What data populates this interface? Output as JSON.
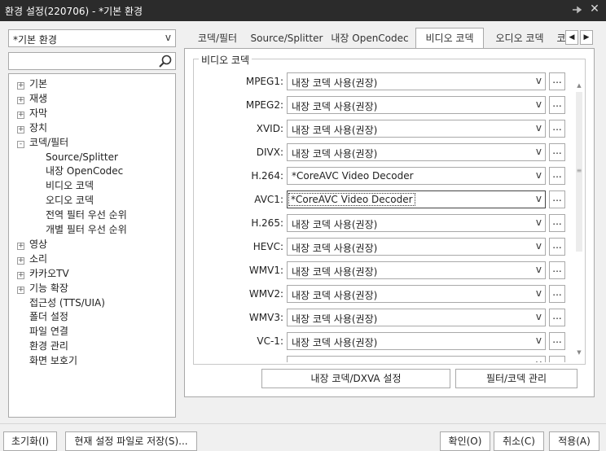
{
  "window": {
    "title": "환경 설정(220706) - *기본 환경",
    "pin_glyph": "‑◆",
    "close_glyph": "✕"
  },
  "profile": {
    "value": "*기본 환경",
    "arrow": "v"
  },
  "search": {
    "value": "",
    "placeholder": ""
  },
  "tree": [
    {
      "label": "기본",
      "level": 0,
      "expander": "+"
    },
    {
      "label": "재생",
      "level": 0,
      "expander": "+"
    },
    {
      "label": "자막",
      "level": 0,
      "expander": "+"
    },
    {
      "label": "장치",
      "level": 0,
      "expander": "+"
    },
    {
      "label": "코덱/필터",
      "level": 0,
      "expander": "-"
    },
    {
      "label": "Source/Splitter",
      "level": 1,
      "expander": ""
    },
    {
      "label": "내장 OpenCodec",
      "level": 1,
      "expander": ""
    },
    {
      "label": "비디오 코덱",
      "level": 1,
      "expander": ""
    },
    {
      "label": "오디오 코덱",
      "level": 1,
      "expander": ""
    },
    {
      "label": "전역 필터 우선 순위",
      "level": 1,
      "expander": ""
    },
    {
      "label": "개별 필터 우선 순위",
      "level": 1,
      "expander": ""
    },
    {
      "label": "영상",
      "level": 0,
      "expander": "+"
    },
    {
      "label": "소리",
      "level": 0,
      "expander": "+"
    },
    {
      "label": "카카오TV",
      "level": 0,
      "expander": "+"
    },
    {
      "label": "기능 확장",
      "level": 0,
      "expander": "+"
    },
    {
      "label": "접근성 (TTS/UIA)",
      "level": 0,
      "expander": ""
    },
    {
      "label": "폴더 설정",
      "level": 0,
      "expander": ""
    },
    {
      "label": "파일 연결",
      "level": 0,
      "expander": ""
    },
    {
      "label": "환경 관리",
      "level": 0,
      "expander": ""
    },
    {
      "label": "화면 보호기",
      "level": 0,
      "expander": ""
    }
  ],
  "tabs": [
    {
      "label": "코덱/필터",
      "active": false
    },
    {
      "label": "Source/Splitter",
      "active": false
    },
    {
      "label": "내장 OpenCodec",
      "active": false
    },
    {
      "label": "비디오 코덱",
      "active": true
    },
    {
      "label": "오디오 코덱",
      "active": false
    },
    {
      "label": "코",
      "active": false
    }
  ],
  "tab_scroll": {
    "left": "◀",
    "right": "▶"
  },
  "group_title": "비디오 코덱",
  "codecs": [
    {
      "name": "MPEG1:",
      "value": "내장 코덱 사용(권장)",
      "focused": false
    },
    {
      "name": "MPEG2:",
      "value": "내장 코덱 사용(권장)",
      "focused": false
    },
    {
      "name": "XVID:",
      "value": "내장 코덱 사용(권장)",
      "focused": false
    },
    {
      "name": "DIVX:",
      "value": "내장 코덱 사용(권장)",
      "focused": false
    },
    {
      "name": "H.264:",
      "value": "*CoreAVC Video Decoder",
      "focused": false
    },
    {
      "name": "AVC1:",
      "value": "*CoreAVC Video Decoder",
      "focused": true
    },
    {
      "name": "H.265:",
      "value": "내장 코덱 사용(권장)",
      "focused": false
    },
    {
      "name": "HEVC:",
      "value": "내장 코덱 사용(권장)",
      "focused": false
    },
    {
      "name": "WMV1:",
      "value": "내장 코덱 사용(권장)",
      "focused": false
    },
    {
      "name": "WMV2:",
      "value": "내장 코덱 사용(권장)",
      "focused": false
    },
    {
      "name": "WMV3:",
      "value": "내장 코덱 사용(권장)",
      "focused": false
    },
    {
      "name": "VC-1:",
      "value": "내장 코덱 사용(권장)",
      "focused": false
    },
    {
      "name": "",
      "value": "",
      "focused": false
    }
  ],
  "codec_arrow": "v",
  "more_label": "...",
  "scroll": {
    "up": "▲",
    "down": "▼",
    "grip": "≡"
  },
  "panel_buttons": {
    "dxva": "내장 코덱/DXVA 설정",
    "filter_manage": "필터/코덱 관리"
  },
  "footer_buttons": {
    "reset": "초기화(I)",
    "save_current": "현재 설정 파일로 저장(S)...",
    "ok": "확인(O)",
    "cancel": "취소(C)",
    "apply": "적용(A)"
  }
}
